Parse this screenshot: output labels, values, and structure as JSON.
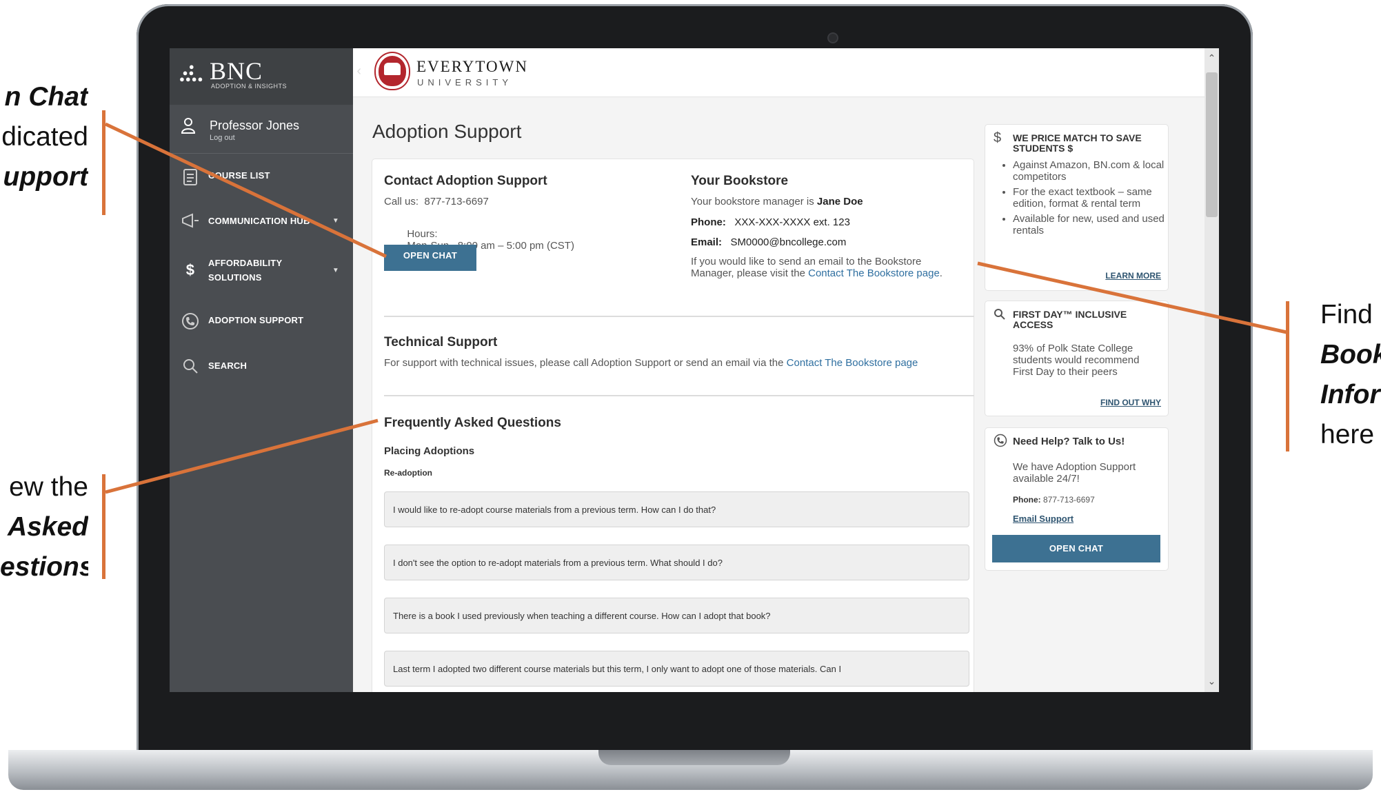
{
  "callouts": {
    "left_top": {
      "line1": "n Chat",
      "line2": "dicated",
      "line3": "upport"
    },
    "left_bottom": {
      "line1": "ew the",
      "line2": "Asked",
      "line3": "estions"
    },
    "right": {
      "line1": "Find",
      "line2": "Book",
      "line3": "Infor",
      "line4": "here"
    }
  },
  "sidebar": {
    "brand": "BNC",
    "brand_sub": "ADOPTION & INSIGHTS",
    "user_name": "Professor Jones",
    "logout": "Log out",
    "items": [
      {
        "label": "COURSE LIST",
        "icon": "clipboard-icon"
      },
      {
        "label": "COMMUNICATION HUB",
        "icon": "megaphone-icon"
      },
      {
        "label": "AFFORDABILITY SOLUTIONS",
        "icon": "dollar-icon"
      },
      {
        "label": "ADOPTION SUPPORT",
        "icon": "phone-icon"
      },
      {
        "label": "SEARCH",
        "icon": "search-icon"
      }
    ]
  },
  "header": {
    "university_name": "EVERYTOWN",
    "university_sub": "UNIVERSITY"
  },
  "main": {
    "page_title": "Adoption Support",
    "contact": {
      "title": "Contact Adoption Support",
      "call_label": "Call us:",
      "call_value": "877-713-6697",
      "hours_label": "Hours:",
      "hours_value": "Mon-Sun   8:00 am – 5:00 pm (CST)",
      "chat_button": "OPEN CHAT"
    },
    "bookstore": {
      "title": "Your Bookstore",
      "manager_prefix": "Your bookstore manager is ",
      "manager_name": "Jane Doe",
      "phone_label": "Phone:",
      "phone_value": "XXX-XXX-XXXX ext. 123",
      "email_label": "Email:",
      "email_value": "SM0000@bncollege.com",
      "note_prefix": "If you would like to send an email to the Bookstore Manager, please visit the ",
      "note_link": "Contact The Bookstore page",
      "note_suffix": "."
    },
    "technical": {
      "title": "Technical Support",
      "text_prefix": "For support with technical issues, please call Adoption Support or send an email via the ",
      "text_link": "Contact The Bookstore page"
    },
    "faq": {
      "title": "Frequently Asked Questions",
      "section": "Placing Adoptions",
      "subsection": "Re-adoption",
      "questions": [
        "I would like to re-adopt course materials from a previous term. How can I do that?",
        "I don't see the option to re-adopt materials from a previous term. What should I do?",
        "There is a book I used previously when teaching a different course. How can I adopt that book?",
        "Last term I adopted two different course materials but this term, I only want to adopt one of those materials. Can I"
      ]
    }
  },
  "rail": {
    "price_match": {
      "title": "WE PRICE MATCH TO SAVE STUDENTS $",
      "bullets": [
        "Against Amazon, BN.com & local competitors",
        "For the exact textbook – same edition, format & rental term",
        "Available for new, used and used rentals"
      ],
      "link": "LEARN MORE"
    },
    "first_day": {
      "title": "FIRST DAY™ INCLUSIVE ACCESS",
      "text": "93% of Polk State College students would recommend First Day to their peers",
      "link": "FIND OUT WHY"
    },
    "help": {
      "title": "Need Help? Talk to Us!",
      "text": "We have Adoption Support available 24/7!",
      "phone_label": "Phone:",
      "phone_value": "877-713-6697",
      "email_link": "Email Support",
      "chat_button": "OPEN CHAT"
    }
  },
  "colors": {
    "accent": "#d9733a",
    "sidebar": "#4a4d51",
    "button": "#3d7192",
    "brand_red": "#b3262d"
  }
}
